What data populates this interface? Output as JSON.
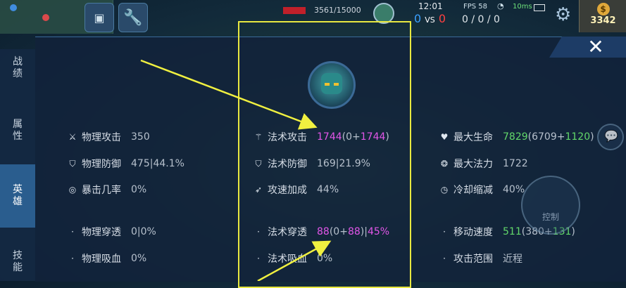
{
  "hud": {
    "hp_text": "3561/15000",
    "time": "12:01",
    "vs_left": "0",
    "vs_label": "VS",
    "vs_right": "0",
    "fps": "FPS 58",
    "ping": "10ms",
    "kda": "0 / 0 / 0",
    "gold": "3342",
    "gold_symbol": "$",
    "icons": [
      "minimap",
      "wrench-icon",
      "settings-gear-icon",
      "wifi-icon",
      "battery-icon",
      "gold-coin-icon"
    ],
    "colors": {
      "blue_team": "#3aa0ff",
      "red_team": "#ff4040",
      "ping": "#6de07a"
    }
  },
  "close_label": "✕",
  "tabs": [
    {
      "label": [
        "战",
        "绩"
      ],
      "active": false
    },
    {
      "label": [
        "属",
        "性"
      ],
      "active": false
    },
    {
      "label": [
        "英",
        "雄"
      ],
      "active": true
    },
    {
      "label": [
        "技",
        "能"
      ],
      "active": false
    }
  ],
  "stats": {
    "col1": [
      {
        "label": "物理攻击",
        "value": "350",
        "icon": "sword-icon"
      },
      {
        "label": "物理防御",
        "value": "475|44.1%",
        "icon": "shield-icon"
      },
      {
        "label": "暴击几率",
        "value": "0%",
        "icon": "target-icon"
      },
      {
        "label": "物理穿透",
        "value": "0|0%",
        "icon": "dot"
      },
      {
        "label": "物理吸血",
        "value": "0%",
        "icon": "dot"
      }
    ],
    "col2": [
      {
        "label": "法术攻击",
        "value_main": "1744",
        "value_open": "(0+",
        "value_bonus": "1744",
        "value_close": ")",
        "icon": "wand-icon"
      },
      {
        "label": "法术防御",
        "value": "169|21.9%",
        "icon": "shield-icon"
      },
      {
        "label": "攻速加成",
        "value": "44%",
        "icon": "speed-icon"
      },
      {
        "label": "法术穿透",
        "value_main": "88",
        "value_open": "(0+",
        "value_bonus": "88",
        "value_close": ")|",
        "value_tail": "45%",
        "icon": "dot"
      },
      {
        "label": "法术吸血",
        "value": "0%",
        "icon": "dot"
      }
    ],
    "col3": [
      {
        "label": "最大生命",
        "value_main": "7829",
        "value_open": "(6709+",
        "value_bonus": "1120",
        "value_close": ")",
        "icon": "heart-icon"
      },
      {
        "label": "最大法力",
        "value": "1722",
        "icon": "mana-icon"
      },
      {
        "label": "冷却缩减",
        "value": "40%",
        "icon": "cooldown-icon"
      },
      {
        "label": "移动速度",
        "value_main": "511",
        "value_open": "(380+",
        "value_bonus": "131",
        "value_close": ")",
        "icon": "dot"
      },
      {
        "label": "攻击范围",
        "value": "近程",
        "icon": "dot"
      }
    ]
  },
  "side_buttons": {
    "control": "控制"
  },
  "colors": {
    "magic_value": "#e256e8",
    "bonus_value": "#62d86a",
    "highlight_box": "#e8e840",
    "arrow": "#f0f040"
  }
}
